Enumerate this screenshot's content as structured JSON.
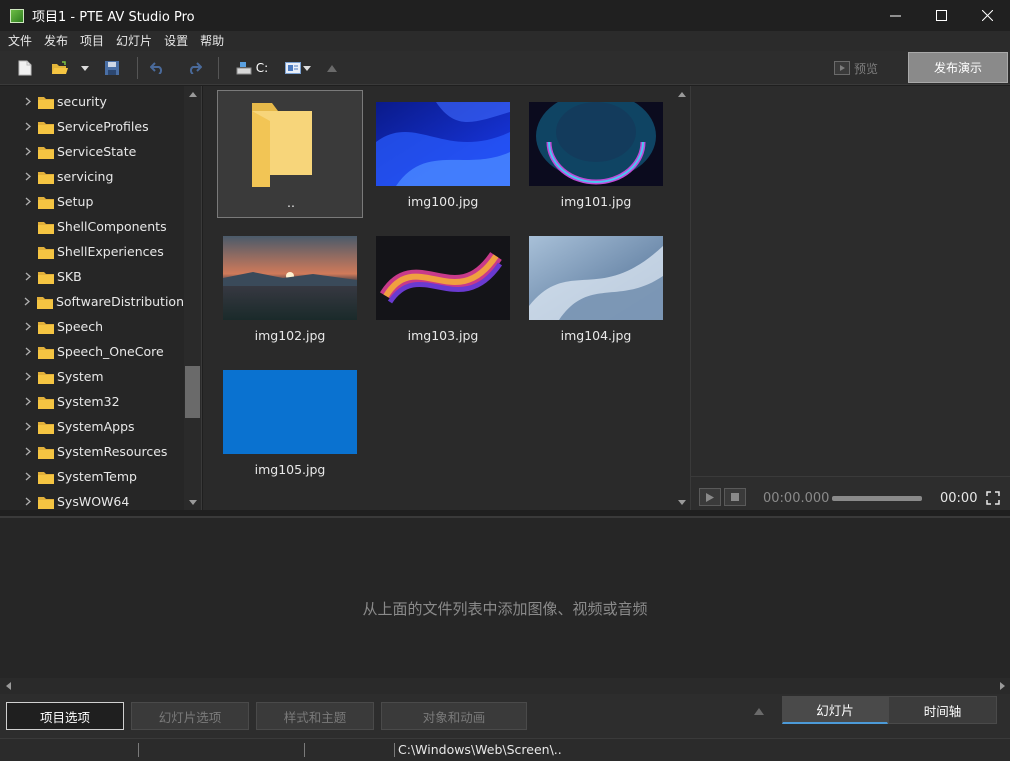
{
  "window": {
    "title": "项目1 - PTE AV Studio Pro"
  },
  "menu": [
    "文件",
    "发布",
    "项目",
    "幻灯片",
    "设置",
    "帮助"
  ],
  "toolbar": {
    "drive_label": "C:",
    "preview_label": "预览",
    "publish_label": "发布演示"
  },
  "tree": {
    "items": [
      {
        "label": "security",
        "has_children": true
      },
      {
        "label": "ServiceProfiles",
        "has_children": true
      },
      {
        "label": "ServiceState",
        "has_children": true
      },
      {
        "label": "servicing",
        "has_children": true
      },
      {
        "label": "Setup",
        "has_children": true
      },
      {
        "label": "ShellComponents",
        "has_children": false
      },
      {
        "label": "ShellExperiences",
        "has_children": false
      },
      {
        "label": "SKB",
        "has_children": true
      },
      {
        "label": "SoftwareDistribution",
        "has_children": true
      },
      {
        "label": "Speech",
        "has_children": true
      },
      {
        "label": "Speech_OneCore",
        "has_children": true
      },
      {
        "label": "System",
        "has_children": true
      },
      {
        "label": "System32",
        "has_children": true
      },
      {
        "label": "SystemApps",
        "has_children": true
      },
      {
        "label": "SystemResources",
        "has_children": true
      },
      {
        "label": "SystemTemp",
        "has_children": true
      },
      {
        "label": "SysWOW64",
        "has_children": true
      }
    ]
  },
  "files": {
    "items": [
      {
        "label": "..",
        "kind": "parent-folder"
      },
      {
        "label": "img100.jpg",
        "kind": "image"
      },
      {
        "label": "img101.jpg",
        "kind": "image"
      },
      {
        "label": "img102.jpg",
        "kind": "image"
      },
      {
        "label": "img103.jpg",
        "kind": "image"
      },
      {
        "label": "img104.jpg",
        "kind": "image"
      },
      {
        "label": "img105.jpg",
        "kind": "image"
      }
    ]
  },
  "player": {
    "current_time": "00:00.000",
    "duration": "00:00"
  },
  "slides": {
    "hint": "从上面的文件列表中添加图像、视频或音频"
  },
  "bottom": {
    "project_options": "项目选项",
    "slide_options": "幻灯片选项",
    "styles_themes": "样式和主题",
    "objects_animation": "对象和动画",
    "tab_slides": "幻灯片",
    "tab_timeline": "时间轴"
  },
  "status": {
    "path": "C:\\Windows\\Web\\Screen\\.."
  },
  "colors": {
    "folder": "#f5c542",
    "accent_blue": "#4c9ad8",
    "img105": "#0a72d0"
  }
}
